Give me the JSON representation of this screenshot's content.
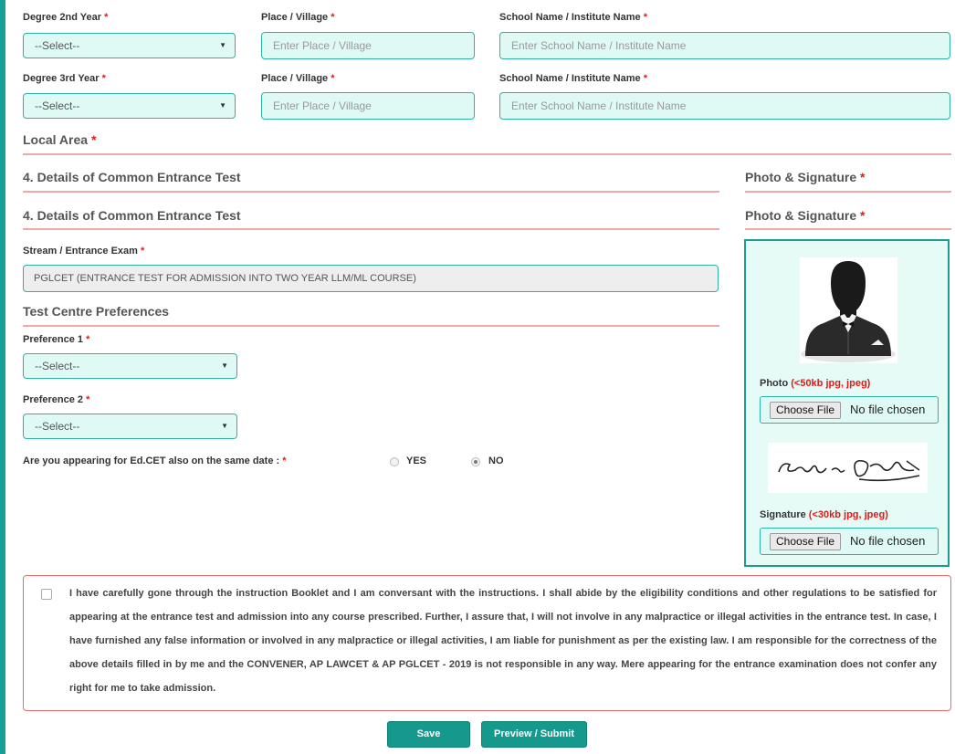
{
  "education": {
    "rows": [
      {
        "year_label": "Degree 2nd Year",
        "year_select": "--Select--",
        "place_label": "Place / Village",
        "place_placeholder": "Enter Place / Village",
        "school_label": "School Name / Institute Name",
        "school_placeholder": "Enter School Name / Institute Name"
      },
      {
        "year_label": "Degree 3rd Year",
        "year_select": "--Select--",
        "place_label": "Place / Village",
        "place_placeholder": "Enter Place / Village",
        "school_label": "School Name / Institute Name",
        "school_placeholder": "Enter School Name / Institute Name"
      }
    ],
    "required_mark": "*"
  },
  "local_area": {
    "title": "Local Area"
  },
  "cet": {
    "title": "4. Details of Common Entrance Test",
    "stream_label": "Stream / Entrance Exam",
    "stream_value": "PGLCET (ENTRANCE TEST FOR ADMISSION INTO TWO YEAR LLM/ML COURSE)",
    "test_centre_title": "Test Centre Preferences",
    "preference1_label": "Preference 1",
    "preference1_value": "--Select--",
    "preference2_label": "Preference 2",
    "preference2_value": "--Select--",
    "edcet_question": "Are you appearing for Ed.CET also on the same date :",
    "yes_label": "YES",
    "no_label": "NO",
    "selected_option": "NO"
  },
  "photo_signature": {
    "title": "Photo & Signature",
    "photo_label": "Photo",
    "photo_hint": "(<50kb jpg, jpeg)",
    "signature_label": "Signature",
    "signature_hint": "(<30kb jpg, jpeg)",
    "choose_file": "Choose File",
    "no_file": "No file chosen"
  },
  "declaration": {
    "text": "I have carefully gone through the instruction Booklet and I am conversant with the instructions. I shall abide by the eligibility conditions and other regulations to be satisfied for appearing at the entrance test and admission into any course prescribed. Further, I assure that, I will not involve in any malpractice or illegal activities in the entrance test. In case, I have furnished any false information or involved in any malpractice or illegal activities, I am liable for punishment as per the existing law. I am responsible for the correctness of the above details filled in by me and the CONVENER, AP LAWCET & AP PGLCET - 2019 is not responsible in any way. Mere appearing for the entrance examination does not confer any right for me to take admission.",
    "checked": false
  },
  "actions": {
    "save": "Save",
    "preview_submit": "Preview / Submit"
  },
  "colors": {
    "accent": "#17a096",
    "required": "#e21a1a",
    "divider": "#f0a7a7",
    "field_bg": "#dffaf4"
  }
}
